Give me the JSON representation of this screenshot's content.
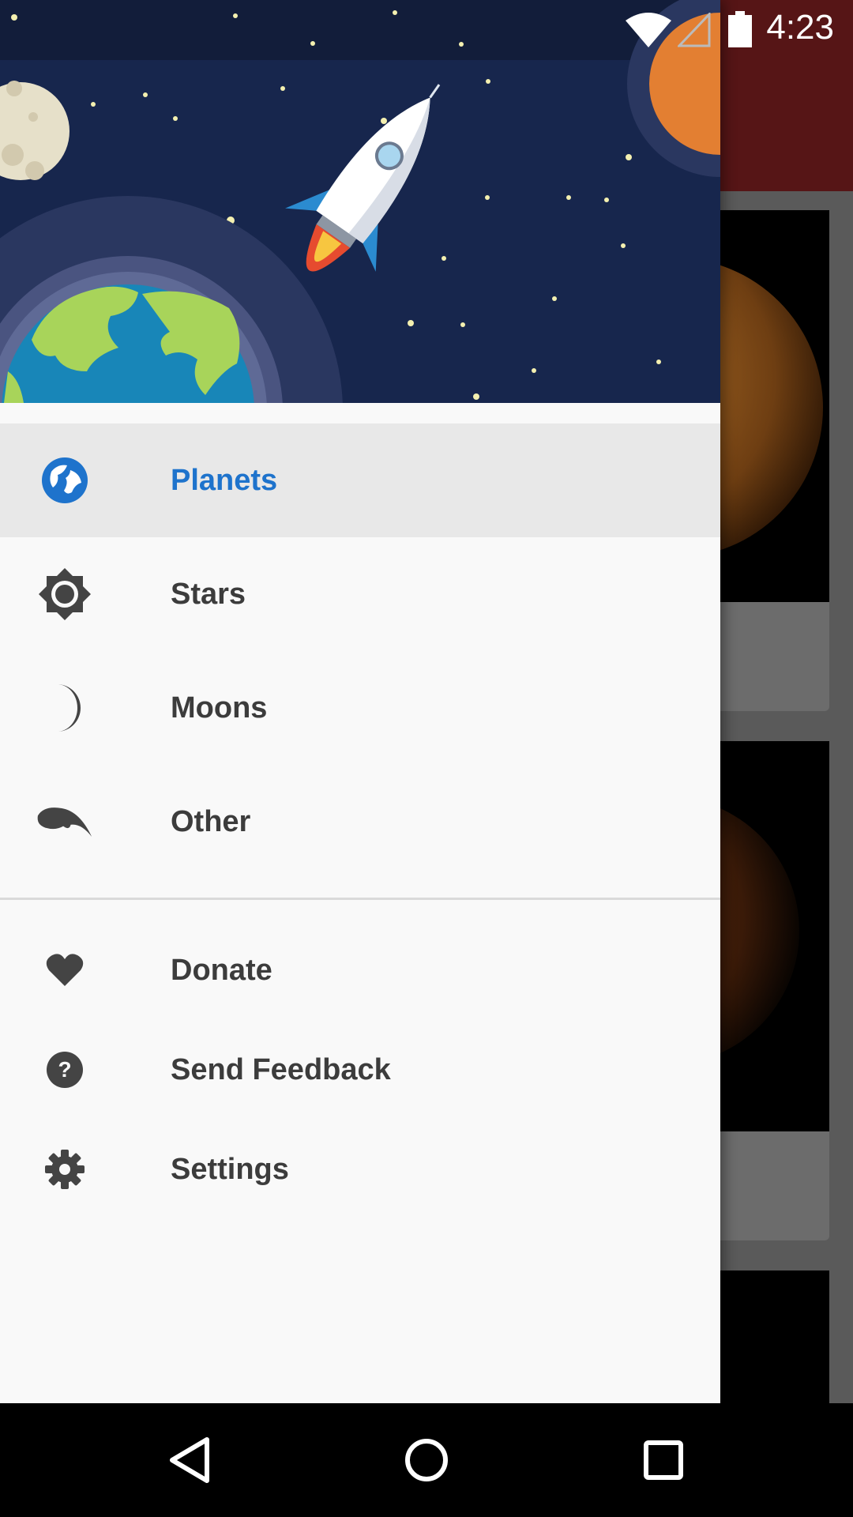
{
  "status_bar": {
    "time": "4:23"
  },
  "drawer": {
    "primary_items": [
      {
        "label": "Planets",
        "icon": "globe-icon",
        "active": true
      },
      {
        "label": "Stars",
        "icon": "sun-icon"
      },
      {
        "label": "Moons",
        "icon": "moon-icon"
      },
      {
        "label": "Other",
        "icon": "comet-icon"
      }
    ],
    "secondary_items": [
      {
        "label": "Donate",
        "icon": "heart-icon"
      },
      {
        "label": "Send Feedback",
        "icon": "help-icon"
      },
      {
        "label": "Settings",
        "icon": "gear-icon"
      }
    ]
  },
  "nav_bar": {
    "buttons": [
      "back-button",
      "home-button",
      "recents-button"
    ]
  },
  "colors": {
    "accent": "#1e73cc",
    "toolbar": "#561516",
    "header_bg": "#17264d",
    "active_row": "#e8e8e8",
    "text": "#3c3c3c"
  }
}
